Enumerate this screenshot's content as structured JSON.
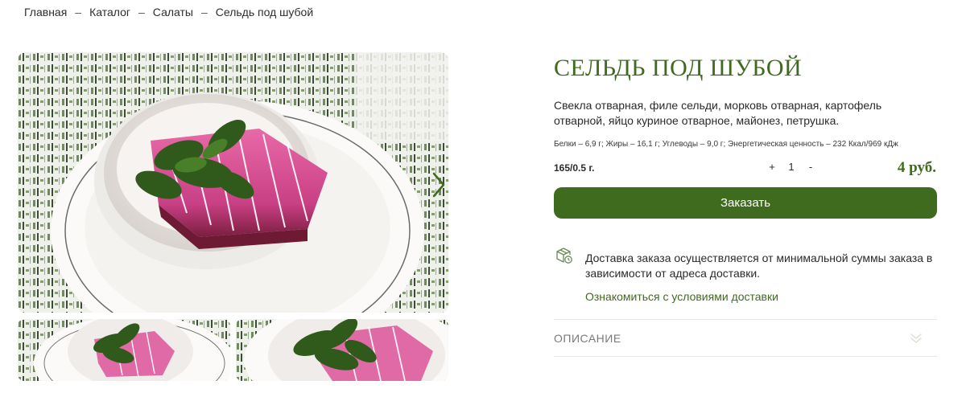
{
  "breadcrumb": {
    "items": [
      "Главная",
      "Каталог",
      "Салаты",
      "Сельдь под шубой"
    ],
    "separator": "–"
  },
  "gallery": {
    "main_image": "herring-under-fur-coat-salad-photo",
    "thumbnails": [
      "herring-salad-thumbnail-1",
      "herring-salad-thumbnail-2"
    ],
    "next_icon": "chevron-right-icon"
  },
  "product": {
    "title": "СЕЛЬДЬ ПОД ШУБОЙ",
    "ingredients": "Свекла отварная, филе сельди, морковь отварная, картофель отварной, яйцо куриное отварное, майонез, петрушка.",
    "nutrition": "Белки – 6,9 г; Жиры – 16,1 г; Углеводы – 9,0 г; Энергетическая ценность – 232 Ккал/969 кДж",
    "weight": "165/0.5 г.",
    "quantity": {
      "minus": "-",
      "plus": "+",
      "value": "1"
    },
    "price": "4 руб.",
    "order_label": "Заказать"
  },
  "delivery": {
    "icon": "delivery-box-icon",
    "text": "Доставка заказа осуществляется от минимальной суммы заказа в зависимости от адреса доставки.",
    "link": "Ознакомиться с условиями доставки"
  },
  "description": {
    "label": "ОПИСАНИЕ",
    "icon": "double-chevron-down-icon"
  },
  "colors": {
    "accent": "#3f6b1f",
    "text": "#2b2b2b",
    "muted": "#7a7a7a",
    "beet": "#e0579a"
  }
}
